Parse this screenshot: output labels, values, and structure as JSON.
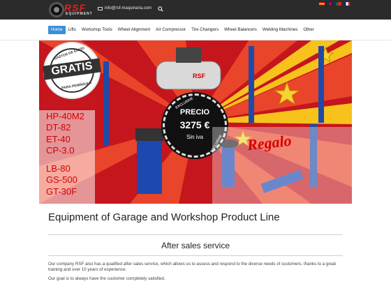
{
  "header": {
    "logo_text": "RSF",
    "logo_sub": "EQUIPMENT",
    "email": "info@rsf-maquinaria.com",
    "search_icon": "search-icon",
    "languages": [
      "es",
      "en",
      "pt",
      "fr"
    ]
  },
  "nav": {
    "items": [
      {
        "label": "Home",
        "active": true
      },
      {
        "label": "Lifts",
        "active": false
      },
      {
        "label": "Workshop Tools",
        "active": false
      },
      {
        "label": "Wheel Alignment",
        "active": false
      },
      {
        "label": "Air Compressor",
        "active": false
      },
      {
        "label": "Tire Changers",
        "active": false
      },
      {
        "label": "Wheel Balancers",
        "active": false
      },
      {
        "label": "Welding Machines",
        "active": false
      },
      {
        "label": "Other",
        "active": false
      }
    ]
  },
  "banner": {
    "gratis_top": "GASTOS DE ENVÍO",
    "gratis_label": "GRATIS",
    "gratis_bottom": "PARA PENINSULA",
    "models": [
      "HP-40M2",
      "DT-82",
      "ET-40",
      "CP-3.0",
      "LB-80",
      "GS-500",
      "GT-30F"
    ],
    "price_label": "PRECIO",
    "price_amount": "3275 €",
    "price_note": "Sin iva",
    "exclusive": "EXCLUSIVE",
    "regalo": "Regalo"
  },
  "main": {
    "title": "Equipment of Garage and Workshop Product Line",
    "subtitle": "After sales service",
    "paragraph1": "Our company RSF also has a qualified after sales service, which allows us to assess and respond to the diverse needs of customers, thanks to a great training and over 10 years of experience.",
    "paragraph2": "Our goal is to always have the customer completely satisfied."
  },
  "colors": {
    "topbar": "#2b2b2b",
    "accent": "#3b8fd6",
    "banner_red": "#c4161c",
    "model_text": "#d40000"
  }
}
